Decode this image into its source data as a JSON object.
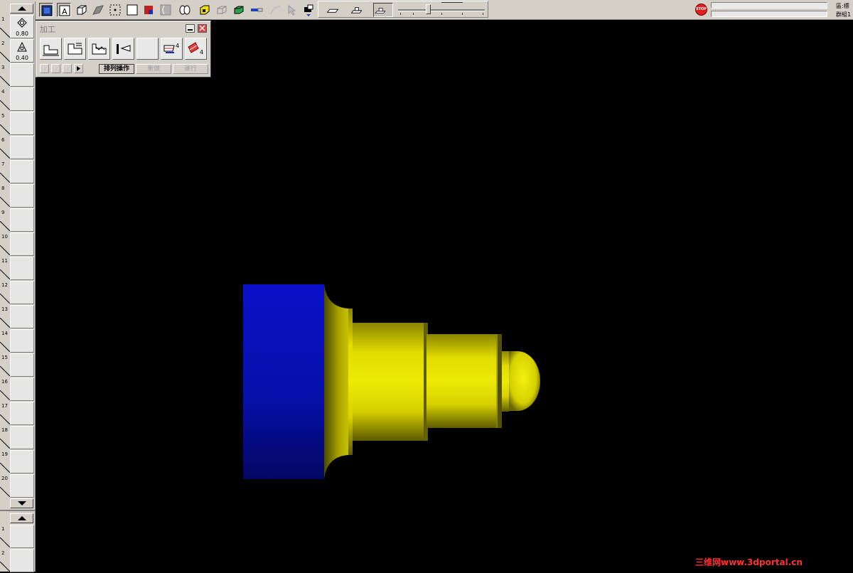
{
  "palette": {
    "title": "加工",
    "minimize_icon": "minimize-icon",
    "close_icon": "close-icon",
    "buttons": [
      "排列操作",
      "重做",
      "運行"
    ],
    "op_counts": {
      "op6": "4",
      "op7": "4"
    }
  },
  "toolbar": {
    "stop_label": "STOP",
    "status_line1": "區:標",
    "status_line2": "群組1"
  },
  "tool_slots": [
    {
      "number": "1",
      "value": "0.80",
      "icon": "round-insert-icon"
    },
    {
      "number": "2",
      "value": "0.40",
      "icon": "triangle-insert-icon"
    },
    {
      "number": "3",
      "value": ""
    },
    {
      "number": "4",
      "value": ""
    },
    {
      "number": "5",
      "value": ""
    },
    {
      "number": "6",
      "value": ""
    },
    {
      "number": "7",
      "value": ""
    },
    {
      "number": "8",
      "value": ""
    },
    {
      "number": "9",
      "value": ""
    },
    {
      "number": "10",
      "value": ""
    },
    {
      "number": "11",
      "value": ""
    },
    {
      "number": "12",
      "value": ""
    },
    {
      "number": "13",
      "value": ""
    },
    {
      "number": "14",
      "value": ""
    },
    {
      "number": "15",
      "value": ""
    },
    {
      "number": "16",
      "value": ""
    },
    {
      "number": "17",
      "value": ""
    },
    {
      "number": "18",
      "value": ""
    },
    {
      "number": "19",
      "value": ""
    },
    {
      "number": "20",
      "value": ""
    }
  ],
  "lower_slots": [
    {
      "number": "1",
      "value": ""
    },
    {
      "number": "2",
      "value": ""
    }
  ],
  "watermark": "三维网www.3dportal.cn",
  "colors": {
    "stock": "#0a10c8",
    "part": "#e8e400",
    "background": "#000000"
  }
}
